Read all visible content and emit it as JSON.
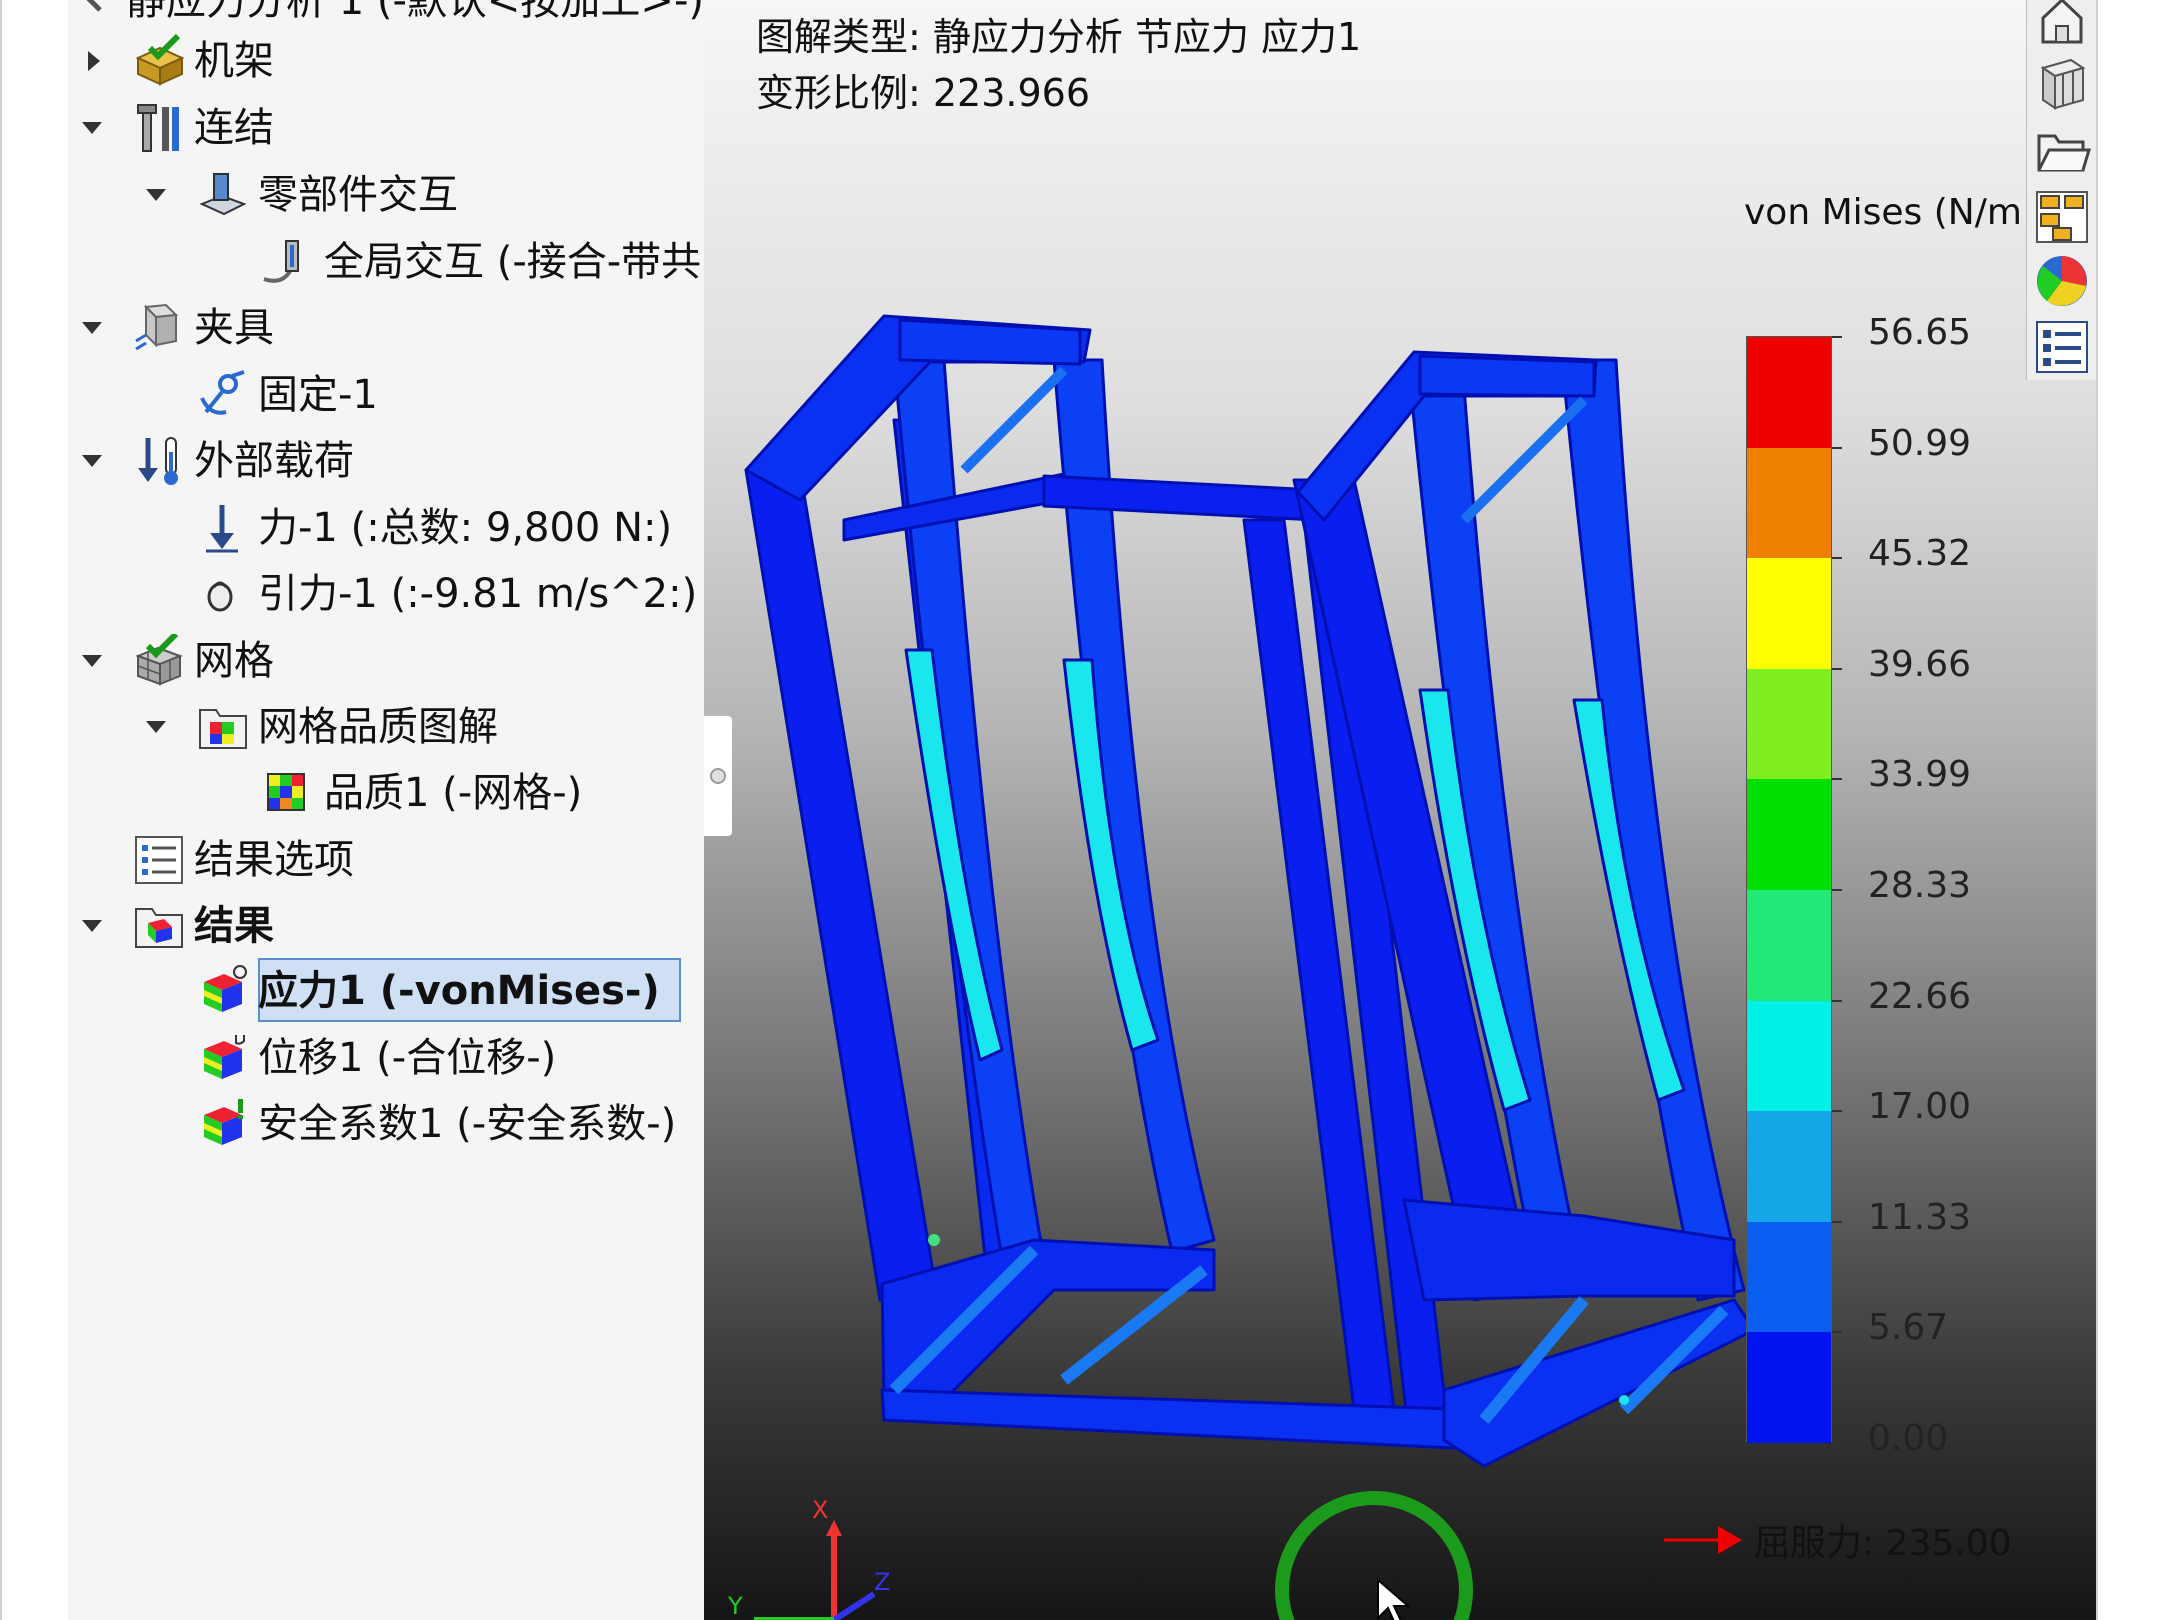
{
  "tree": {
    "study_partial": "静应力分析 1 (-默认<按加工>-)",
    "items": [
      {
        "label": "机架",
        "icon": "part-icon",
        "caret": "right"
      },
      {
        "label": "连结",
        "icon": "connections-icon",
        "caret": "down"
      },
      {
        "label": "零部件交互",
        "icon": "component-interaction-icon",
        "caret": "down"
      },
      {
        "label": "全局交互 (-接合-带共",
        "icon": "global-interaction-icon",
        "caret": ""
      },
      {
        "label": "夹具",
        "icon": "fixtures-icon",
        "caret": "down"
      },
      {
        "label": "固定-1",
        "icon": "fixed-anchor-icon",
        "caret": ""
      },
      {
        "label": "外部载荷",
        "icon": "external-loads-icon",
        "caret": "down"
      },
      {
        "label": "力-1 (:总数: 9,800 N:)",
        "icon": "force-arrow-icon",
        "caret": ""
      },
      {
        "label": "引力-1 (:-9.81 m/s^2:)",
        "icon": "gravity-icon",
        "caret": ""
      },
      {
        "label": "网格",
        "icon": "mesh-icon",
        "caret": "down"
      },
      {
        "label": "网格品质图解",
        "icon": "mesh-quality-plot-icon",
        "caret": "down"
      },
      {
        "label": "品质1 (-网格-)",
        "icon": "quality-plot-icon",
        "caret": ""
      },
      {
        "label": "结果选项",
        "icon": "result-options-icon",
        "caret": ""
      },
      {
        "label": "结果",
        "icon": "results-folder-icon",
        "caret": "down"
      },
      {
        "label": "应力1 (-vonMises-)",
        "icon": "stress-plot-icon",
        "caret": "",
        "selected": true
      },
      {
        "label": "位移1 (-合位移-)",
        "icon": "displacement-plot-icon",
        "caret": ""
      },
      {
        "label": "安全系数1 (-安全系数-)",
        "icon": "factor-of-safety-icon",
        "caret": ""
      }
    ]
  },
  "viewport": {
    "plot_type": "图解类型: 静应力分析 节应力 应力1",
    "deform_scale": "变形比例: 223.966",
    "legend_title": "von Mises (N/m",
    "yield": "屈服力: 235.00",
    "axis_x": "X",
    "axis_y": "Y",
    "axis_z": "Z"
  },
  "legend": {
    "values": [
      "56.65",
      "50.99",
      "45.32",
      "39.66",
      "33.99",
      "28.33",
      "22.66",
      "17.00",
      "11.33",
      "5.67",
      "0.00"
    ],
    "colors": [
      "#ee0000",
      "#f08000",
      "#ffff00",
      "#80ef20",
      "#00e000",
      "#22e878",
      "#00f0e8",
      "#14a6e6",
      "#0a5ef0",
      "#0014f0"
    ]
  },
  "toolbar": {
    "buttons": [
      "home-icon",
      "parts-icon",
      "folder-icon",
      "view-palette-icon",
      "appearance-icon",
      "list-icon"
    ]
  }
}
